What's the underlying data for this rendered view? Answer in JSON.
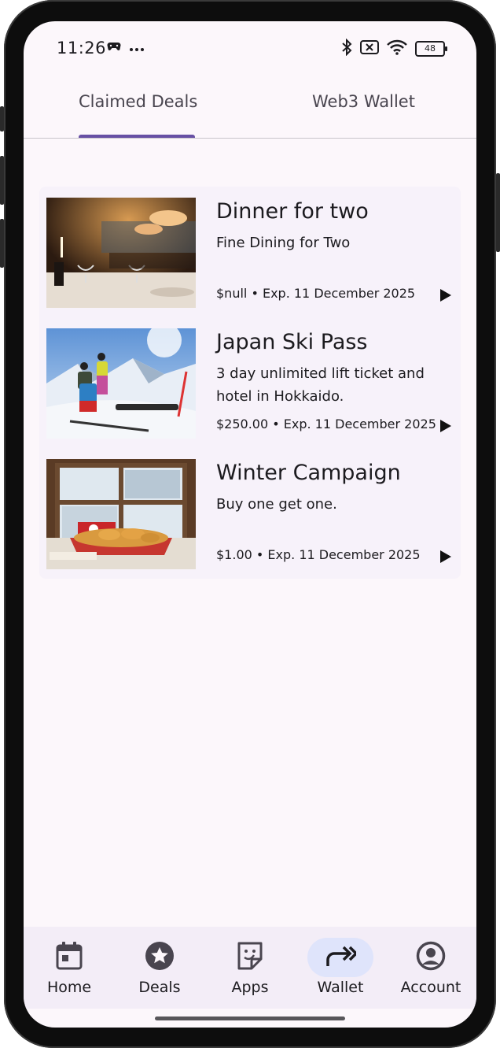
{
  "status_bar": {
    "time": "11:26",
    "left_icons": [
      "game-controller-icon",
      "more-dots-icon"
    ],
    "right_icons": [
      "bluetooth-icon",
      "no-sim-icon",
      "wifi-icon"
    ],
    "battery": "48"
  },
  "tabs": [
    {
      "label": "Claimed Deals",
      "active": true
    },
    {
      "label": "Web3 Wallet",
      "active": false
    }
  ],
  "deals": [
    {
      "title": "Dinner for two",
      "description": "Fine Dining for Two",
      "meta": "$null • Exp. 11 December 2025",
      "image": "restaurant-dining-photo"
    },
    {
      "title": "Japan Ski Pass",
      "description": "3 day unlimited lift ticket and hotel in Hokkaido.",
      "meta": "$250.00 • Exp. 11 December 2025",
      "image": "skiers-on-mountain-photo"
    },
    {
      "title": "Winter Campaign",
      "description": "Buy one get one.",
      "meta": "$1.00 • Exp. 11 December 2025",
      "image": "fried-food-basket-photo"
    }
  ],
  "bottom_nav": [
    {
      "label": "Home",
      "icon": "calendar-icon",
      "active": false
    },
    {
      "label": "Deals",
      "icon": "star-circle-icon",
      "active": false
    },
    {
      "label": "Apps",
      "icon": "sticker-icon",
      "active": false
    },
    {
      "label": "Wallet",
      "icon": "forward-arrows-icon",
      "active": true
    },
    {
      "label": "Account",
      "icon": "account-circle-icon",
      "active": false
    }
  ],
  "colors": {
    "background": "#fcf7fb",
    "accent": "#6750a4",
    "active_nav_pill": "#dfe4fb",
    "text": "#1c1b1f"
  }
}
